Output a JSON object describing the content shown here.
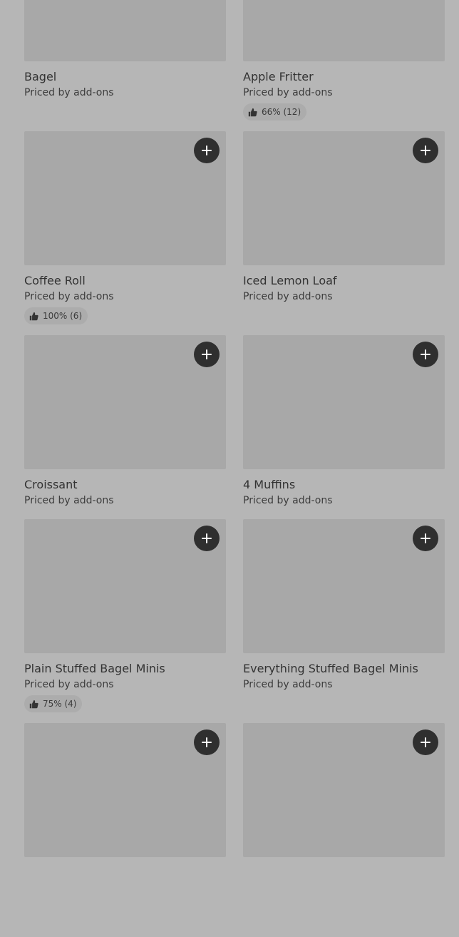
{
  "items": [
    {
      "name": "Bagel",
      "price": "Priced by add-ons",
      "rating": ""
    },
    {
      "name": "Apple Fritter",
      "price": "Priced by add-ons",
      "rating": "66% (12)"
    },
    {
      "name": "Coffee Roll",
      "price": "Priced by add-ons",
      "rating": "100% (6)"
    },
    {
      "name": "Iced Lemon Loaf",
      "price": "Priced by add-ons",
      "rating": ""
    },
    {
      "name": "Croissant",
      "price": "Priced by add-ons",
      "rating": ""
    },
    {
      "name": "4 Muffins",
      "price": "Priced by add-ons",
      "rating": ""
    },
    {
      "name": "Plain Stuffed Bagel Minis",
      "price": "Priced by add-ons",
      "rating": "75% (4)"
    },
    {
      "name": "Everything Stuffed Bagel Minis",
      "price": "Priced by add-ons",
      "rating": ""
    },
    {
      "name": "",
      "price": "",
      "rating": ""
    },
    {
      "name": "",
      "price": "",
      "rating": ""
    }
  ],
  "icons": {
    "add": "plus-icon",
    "rating": "thumbs-up-icon"
  },
  "colors": {
    "page_background": "#b6b6b6",
    "image_placeholder": "#a8a8a8",
    "add_button": "#2f2f2f",
    "rating_pill": "#acacac"
  }
}
